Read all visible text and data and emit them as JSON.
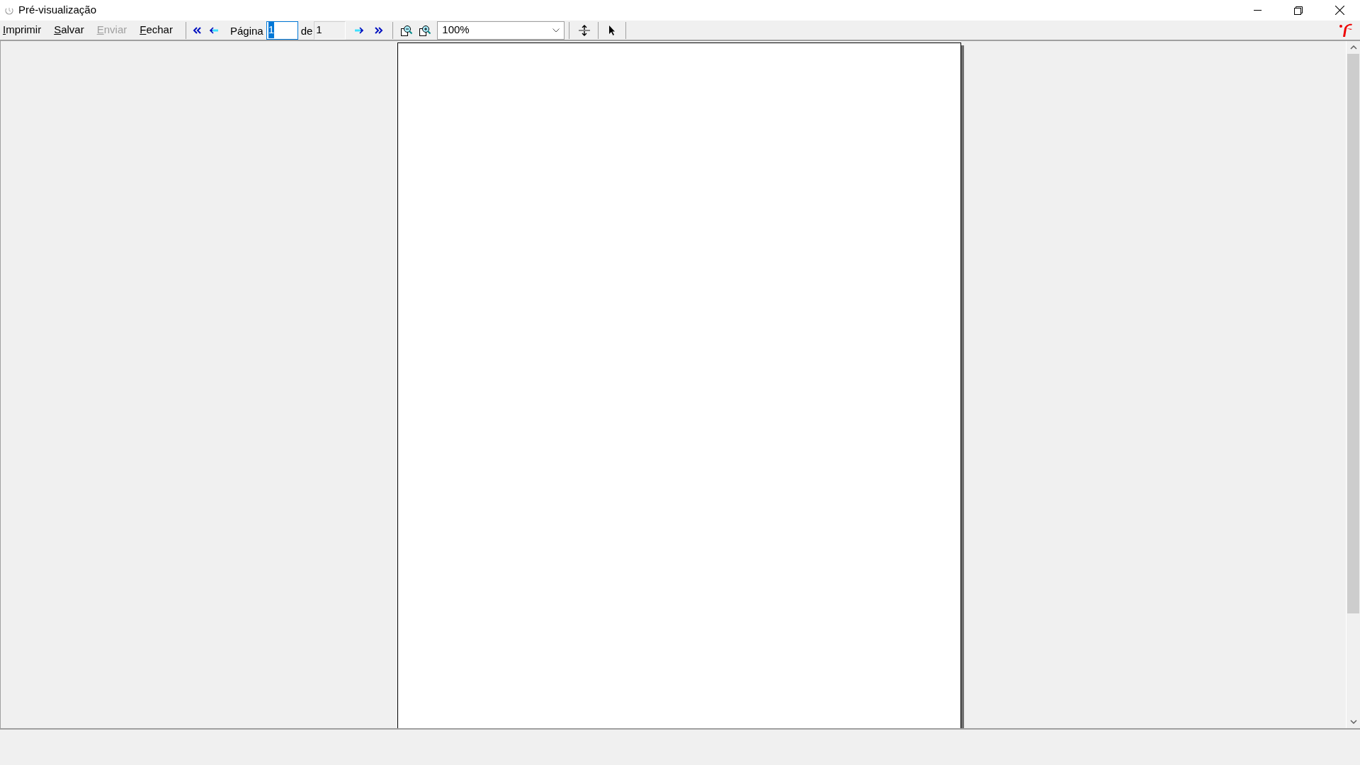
{
  "window": {
    "title": "Pré-visualização"
  },
  "toolbar": {
    "commands": [
      {
        "label": "Imprimir",
        "mnemonic_underlined": true,
        "disabled": false
      },
      {
        "label": "Salvar",
        "mnemonic_underlined": true,
        "disabled": false
      },
      {
        "label": "Enviar",
        "mnemonic_underlined": true,
        "disabled": true
      },
      {
        "label": "Fechar",
        "mnemonic_underlined": true,
        "disabled": false
      }
    ],
    "page_label": "Página",
    "page_field": {
      "value": "1",
      "selected": true
    },
    "of_label": "de",
    "total_field": {
      "value": "1"
    },
    "zoom": {
      "value": "100%"
    }
  }
}
